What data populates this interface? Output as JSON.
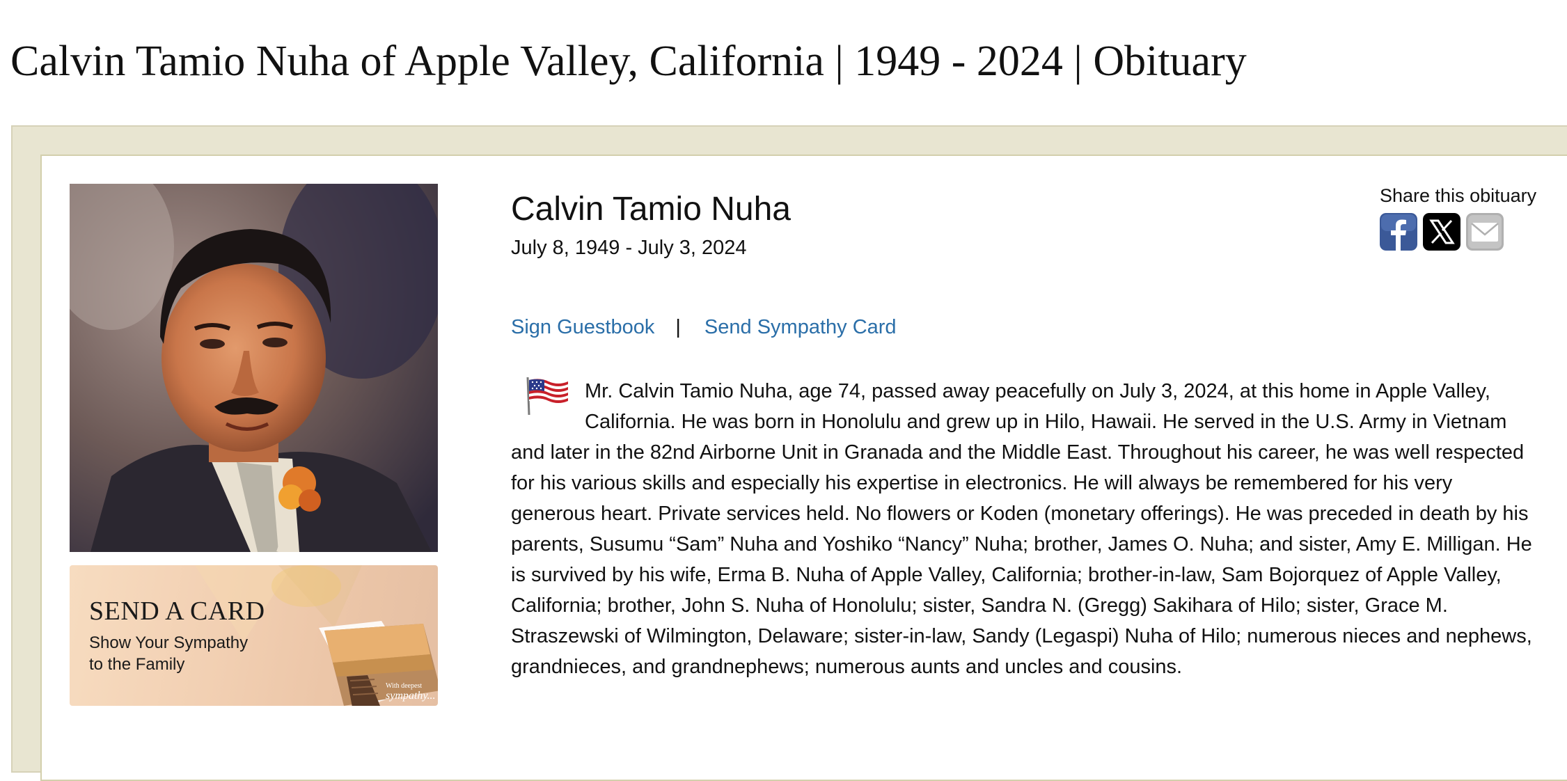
{
  "page": {
    "title": "Calvin Tamio Nuha of Apple Valley, California | 1949 - 2024 | Obituary"
  },
  "obituary": {
    "name": "Calvin Tamio Nuha",
    "dates": "July 8, 1949 - July 3, 2024",
    "body": "Mr. Calvin Tamio Nuha, age 74, passed away peacefully on July 3, 2024, at this home in Apple Valley, California. He was born in Honolulu and grew up in Hilo, Hawaii. He served in the U.S. Army in Vietnam and later in the 82nd Airborne Unit in Granada and the Middle East. Throughout his career, he was well respected for his various skills and especially his expertise in electronics. He will always be remembered for his very generous heart. Private services held. No flowers or Koden (monetary offerings). He was preceded in death by his parents, Susumu “Sam” Nuha and Yoshiko “Nancy” Nuha; brother, James O. Nuha; and sister, Amy E. Milligan. He is survived by his wife, Erma B. Nuha of Apple Valley, California; brother-in-law, Sam Bojorquez of Apple Valley, California; brother, John S. Nuha of Honolulu; sister, Sandra N. (Gregg) Sakihara of Hilo; sister, Grace M. Straszewski of Wilmington, Delaware; sister-in-law, Sandy (Legaspi) Nuha of Hilo; numerous nieces and nephews, grandnieces, and grandnephews; numerous aunts and uncles and cousins."
  },
  "links": {
    "guestbook": "Sign Guestbook",
    "separator": "|",
    "sympathy_card": "Send Sympathy Card"
  },
  "share": {
    "label": "Share this obituary",
    "icons": [
      "facebook-icon",
      "x-icon",
      "email-icon"
    ],
    "facebook_color": "#3b5998",
    "x_color": "#000000",
    "email_color": "#b0b0b0"
  },
  "send_card": {
    "title": "SEND A CARD",
    "subtitle_line1": "Show Your Sympathy",
    "subtitle_line2": "to the Family",
    "card_text_small": "With deepest",
    "card_text_script": "sympathy..."
  },
  "colors": {
    "frame_bg": "#e8e5d1",
    "link": "#2a6ea8",
    "text": "#111111"
  }
}
